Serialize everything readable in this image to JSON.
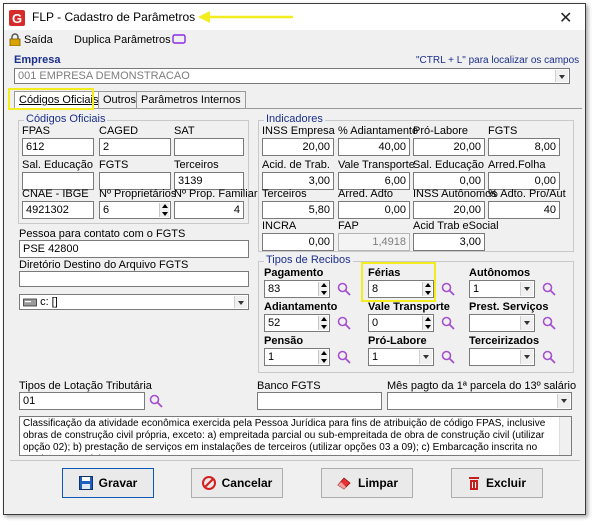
{
  "window": {
    "title": "FLP - Cadastro de Parâmetros"
  },
  "toolbar": {
    "exit_label": "Saída",
    "duplicate_label": "Duplica Parâmetros"
  },
  "company": {
    "label": "Empresa",
    "hint": "\"CTRL + L\" para localizar os campos",
    "value": "001 EMPRESA DEMONSTRACAO"
  },
  "tabs": [
    "Códigos Oficiais",
    "Outros",
    "Parâmetros Internos"
  ],
  "official_codes": {
    "title": "Códigos Oficiais",
    "fpas": {
      "label": "FPAS",
      "value": "612"
    },
    "caged": {
      "label": "CAGED",
      "value": "2"
    },
    "sat": {
      "label": "SAT",
      "value": ""
    },
    "sal_educacao": {
      "label": "Sal. Educação",
      "value": ""
    },
    "fgts": {
      "label": "FGTS",
      "value": ""
    },
    "terceiros": {
      "label": "Terceiros",
      "value": "3139"
    },
    "cnae": {
      "label": "CNAE - IBGE",
      "value": "4921302"
    },
    "n_proprietarios": {
      "label": "Nº Proprietários",
      "value": "6"
    },
    "n_prop_familiar": {
      "label": "Nº Prop. Familiar",
      "value": "4"
    }
  },
  "contact": {
    "label": "Pessoa para contato com o FGTS",
    "value": "PSE 42800"
  },
  "fgts_dir": {
    "label": "Diretório Destino do Arquivo FGTS",
    "value": "",
    "drive": "c: []"
  },
  "indicators": {
    "title": "Indicadores",
    "items": [
      {
        "label": "INSS Empresa",
        "value": "20,00"
      },
      {
        "label": "% Adiantamento",
        "value": "40,00"
      },
      {
        "label": "Pró-Labore",
        "value": "20,00"
      },
      {
        "label": "FGTS",
        "value": "8,00"
      },
      {
        "label": "Acid. de Trab.",
        "value": "3,00"
      },
      {
        "label": "Vale Transporte",
        "value": "6,00"
      },
      {
        "label": "Sal. Educação",
        "value": "0,00"
      },
      {
        "label": "Arred.Folha",
        "value": "0,00"
      },
      {
        "label": "Terceiros",
        "value": "5,80"
      },
      {
        "label": "Arred. Adto",
        "value": "0,00"
      },
      {
        "label": "INSS Autônomos",
        "value": "20,00"
      },
      {
        "label": "% Adto. Pro/Aut",
        "value": "40"
      },
      {
        "label": "INCRA",
        "value": "0,00"
      },
      {
        "label": "FAP",
        "value": "1,4918"
      },
      {
        "label": "Acid Trab eSocial",
        "value": "3,00"
      }
    ]
  },
  "receipts": {
    "title": "Tipos de Recibos",
    "pagamento": {
      "label": "Pagamento",
      "value": "83"
    },
    "ferias": {
      "label": "Férias",
      "value": "8"
    },
    "autonomos": {
      "label": "Autônomos",
      "value": "1"
    },
    "adiantamento": {
      "label": "Adiantamento",
      "value": "52"
    },
    "vale_transporte": {
      "label": "Vale Transporte",
      "value": "0"
    },
    "prest_servicos": {
      "label": "Prest. Serviços",
      "value": ""
    },
    "pensao": {
      "label": "Pensão",
      "value": "1"
    },
    "pro_labore": {
      "label": "Pró-Labore",
      "value": "1"
    },
    "terceirizados": {
      "label": "Terceirizados",
      "value": ""
    }
  },
  "lotacao": {
    "label": "Tipos de Lotação Tributária",
    "value": "01"
  },
  "banco_fgts": {
    "label": "Banco FGTS",
    "value": ""
  },
  "mes_13": {
    "label": "Mês pagto da 1ª parcela do 13º salário",
    "value": ""
  },
  "description": "Classificação da atividade econômica exercida pela Pessoa Jurídica para fins de atribuição de código FPAS, inclusive obras de construção civil própria, exceto: a) empreitada parcial ou sub-empreitada de obra de construção civil (utilizar opção 02); b) prestação de serviços em instalações de terceiros (utilizar opções 03 a 09); c) Embarcação inscrita no Registro Especial",
  "buttons": {
    "save": "Gravar",
    "cancel": "Cancelar",
    "clear": "Limpar",
    "delete": "Excluir"
  },
  "colors": {
    "highlight": "#f3ec1f",
    "group_title": "#1b2f8c",
    "search_icon": "#a64fd0"
  }
}
